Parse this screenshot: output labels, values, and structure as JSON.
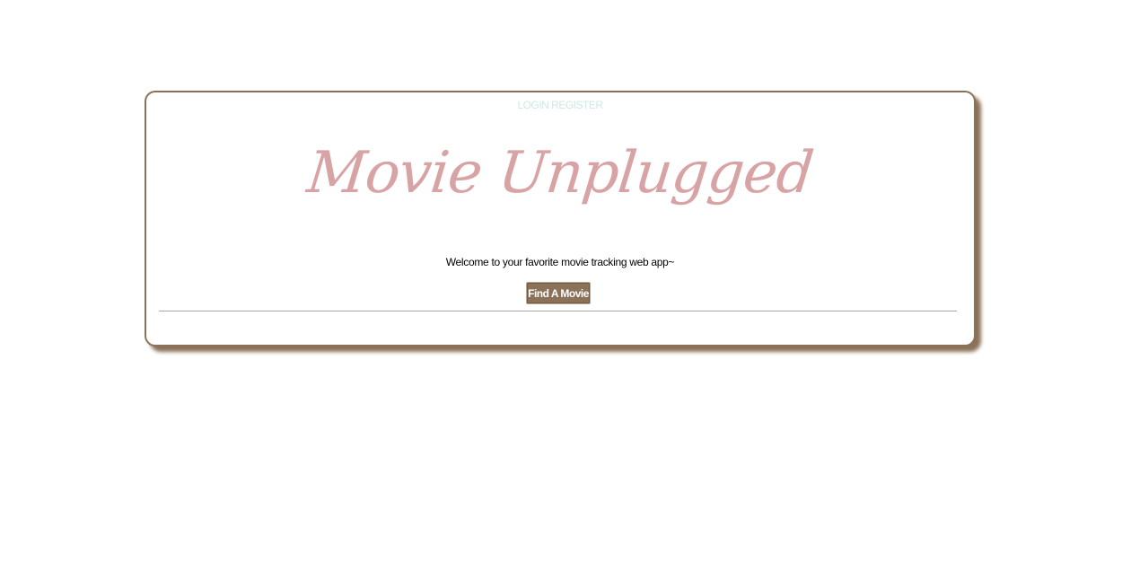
{
  "nav": {
    "login_label": "LOGIN",
    "register_label": "REGISTER"
  },
  "hero": {
    "title": "Movie Unplugged",
    "welcome_text": "Welcome to your favorite movie tracking web app~"
  },
  "actions": {
    "find_movie_label": "Find A Movie"
  },
  "colors": {
    "accent_brown": "#8b7158",
    "title_pink": "#d8a3a5",
    "link_mint": "#cde9e4",
    "divider_gray": "#a8a8a8"
  }
}
